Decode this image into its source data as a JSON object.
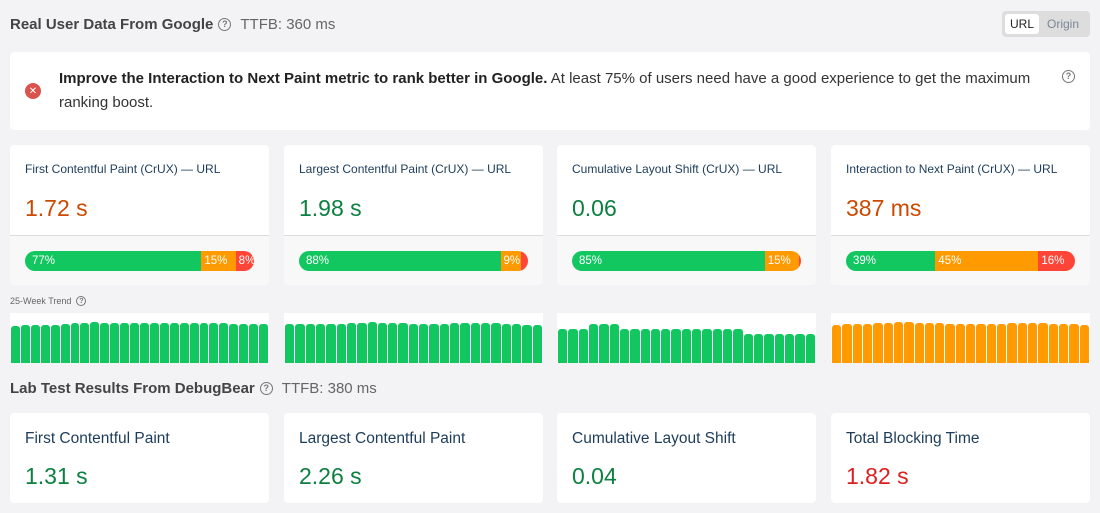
{
  "real_user": {
    "title": "Real User Data From Google",
    "help_icon": "question-circle-icon",
    "ttfb": "TTFB: 360 ms",
    "toggle": {
      "options": [
        "URL",
        "Origin"
      ],
      "selected": "URL"
    }
  },
  "alert": {
    "icon": "error-x-circle-icon",
    "bold_text": "Improve the Interaction to Next Paint metric to rank better in Google.",
    "text": " At least 75% of users need have a good experience to get the maximum ranking boost.",
    "help_icon": "question-circle-icon"
  },
  "crux_cards": [
    {
      "label": "First Contentful Paint (CrUX) — URL",
      "value": "1.72 s",
      "status": "ni",
      "distribution": {
        "good": 77,
        "ni": 15,
        "poor": 8
      },
      "distribution_labels": {
        "good": "77%",
        "ni": "15%",
        "poor": "8%"
      }
    },
    {
      "label": "Largest Contentful Paint (CrUX) — URL",
      "value": "1.98 s",
      "status": "good",
      "distribution": {
        "good": 88,
        "ni": 9,
        "poor": 3
      },
      "distribution_labels": {
        "good": "88%",
        "ni": "9%",
        "poor": ""
      }
    },
    {
      "label": "Cumulative Layout Shift (CrUX) — URL",
      "value": "0.06",
      "status": "good",
      "distribution": {
        "good": 85,
        "ni": 15,
        "poor": 1
      },
      "distribution_labels": {
        "good": "85%",
        "ni": "15%",
        "poor": ""
      }
    },
    {
      "label": "Interaction to Next Paint (CrUX) — URL",
      "value": "387 ms",
      "status": "ni",
      "distribution": {
        "good": 39,
        "ni": 45,
        "poor": 16
      },
      "distribution_labels": {
        "good": "39%",
        "ni": "45%",
        "poor": "16%"
      }
    }
  ],
  "trend": {
    "label": "25-Week Trend",
    "help_icon": "question-circle-icon",
    "colors": {
      "good": "#12c760",
      "ni": "#ff9a00",
      "poor": "#ff4438"
    },
    "series": [
      {
        "metric": "First Contentful Paint",
        "status": "good",
        "values": [
          74,
          76,
          76,
          76,
          76,
          78,
          80,
          80,
          82,
          80,
          80,
          80,
          80,
          80,
          80,
          80,
          80,
          80,
          80,
          80,
          80,
          80,
          78,
          78,
          78,
          78
        ]
      },
      {
        "metric": "Largest Contentful Paint",
        "status": "good",
        "values": [
          78,
          78,
          78,
          78,
          78,
          78,
          80,
          80,
          82,
          80,
          80,
          80,
          78,
          78,
          78,
          78,
          80,
          80,
          80,
          80,
          80,
          78,
          78,
          76,
          76
        ]
      },
      {
        "metric": "Cumulative Layout Shift",
        "status": "good",
        "values": [
          68,
          68,
          68,
          78,
          78,
          78,
          68,
          68,
          68,
          68,
          68,
          68,
          68,
          68,
          68,
          68,
          68,
          68,
          58,
          58,
          58,
          58,
          58,
          58,
          58
        ]
      },
      {
        "metric": "Interaction to Next Paint",
        "status": "ni",
        "values": [
          76,
          78,
          78,
          78,
          80,
          80,
          82,
          82,
          80,
          80,
          80,
          78,
          78,
          78,
          78,
          78,
          78,
          80,
          80,
          80,
          80,
          78,
          78,
          78,
          76
        ]
      }
    ]
  },
  "lab": {
    "title": "Lab Test Results From DebugBear",
    "help_icon": "question-circle-icon",
    "ttfb": "TTFB: 380 ms",
    "cards": [
      {
        "label": "First Contentful Paint",
        "value": "1.31 s",
        "status": "good"
      },
      {
        "label": "Largest Contentful Paint",
        "value": "2.26 s",
        "status": "good"
      },
      {
        "label": "Cumulative Layout Shift",
        "value": "0.04",
        "status": "good"
      },
      {
        "label": "Total Blocking Time",
        "value": "1.82 s",
        "status": "poor"
      }
    ]
  }
}
